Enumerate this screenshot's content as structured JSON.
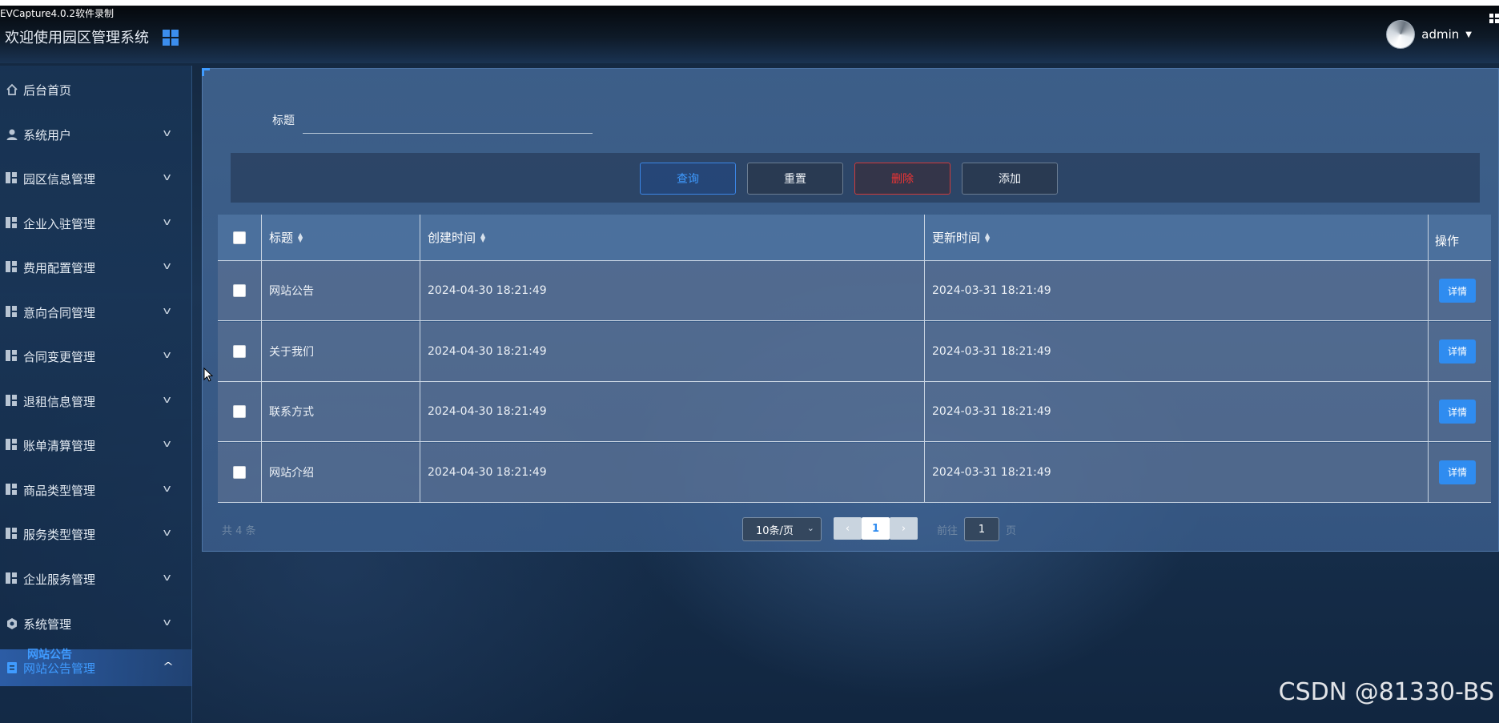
{
  "recorder_text": "EVCapture4.0.2软件录制",
  "header": {
    "title": "欢迎使用园区管理系统",
    "user": "admin"
  },
  "sidebar": {
    "items": [
      {
        "label": "后台首页",
        "icon": "home-icon",
        "expandable": false
      },
      {
        "label": "系统用户",
        "icon": "user-icon",
        "expandable": true
      },
      {
        "label": "园区信息管理",
        "icon": "grid-icon",
        "expandable": true
      },
      {
        "label": "企业入驻管理",
        "icon": "grid-icon",
        "expandable": true
      },
      {
        "label": "费用配置管理",
        "icon": "grid-icon",
        "expandable": true
      },
      {
        "label": "意向合同管理",
        "icon": "grid-icon",
        "expandable": true
      },
      {
        "label": "合同变更管理",
        "icon": "grid-icon",
        "expandable": true
      },
      {
        "label": "退租信息管理",
        "icon": "grid-icon",
        "expandable": true
      },
      {
        "label": "账单清算管理",
        "icon": "grid-icon",
        "expandable": true
      },
      {
        "label": "商品类型管理",
        "icon": "grid-icon",
        "expandable": true
      },
      {
        "label": "服务类型管理",
        "icon": "grid-icon",
        "expandable": true
      },
      {
        "label": "企业服务管理",
        "icon": "grid-icon",
        "expandable": true
      },
      {
        "label": "系统管理",
        "icon": "gear-icon",
        "expandable": true
      },
      {
        "label": "网站公告管理",
        "icon": "doc-icon",
        "expandable": true,
        "active": true
      }
    ],
    "sub_item": "网站公告"
  },
  "search": {
    "label": "标题",
    "value": "",
    "placeholder": ""
  },
  "buttons": {
    "query": "查询",
    "reset": "重置",
    "delete": "删除",
    "add": "添加"
  },
  "table": {
    "columns": [
      "标题",
      "创建时间",
      "更新时间",
      "操作"
    ],
    "rows": [
      {
        "title": "网站公告",
        "created": "2024-04-30 18:21:49",
        "updated": "2024-03-31 18:21:49",
        "action": "详情"
      },
      {
        "title": "关于我们",
        "created": "2024-04-30 18:21:49",
        "updated": "2024-03-31 18:21:49",
        "action": "详情"
      },
      {
        "title": "联系方式",
        "created": "2024-04-30 18:21:49",
        "updated": "2024-03-31 18:21:49",
        "action": "详情"
      },
      {
        "title": "网站介绍",
        "created": "2024-04-30 18:21:49",
        "updated": "2024-03-31 18:21:49",
        "action": "详情"
      }
    ]
  },
  "pager": {
    "total": "共 4 条",
    "page_size": "10条/页",
    "current_page": "1",
    "goto_prefix": "前往",
    "goto_value": "1",
    "goto_suffix": "页"
  },
  "watermark": "CSDN @81330-BS",
  "colors": {
    "accent": "#2f8cf0",
    "danger": "#f03434",
    "active_text": "#3f9bff"
  }
}
